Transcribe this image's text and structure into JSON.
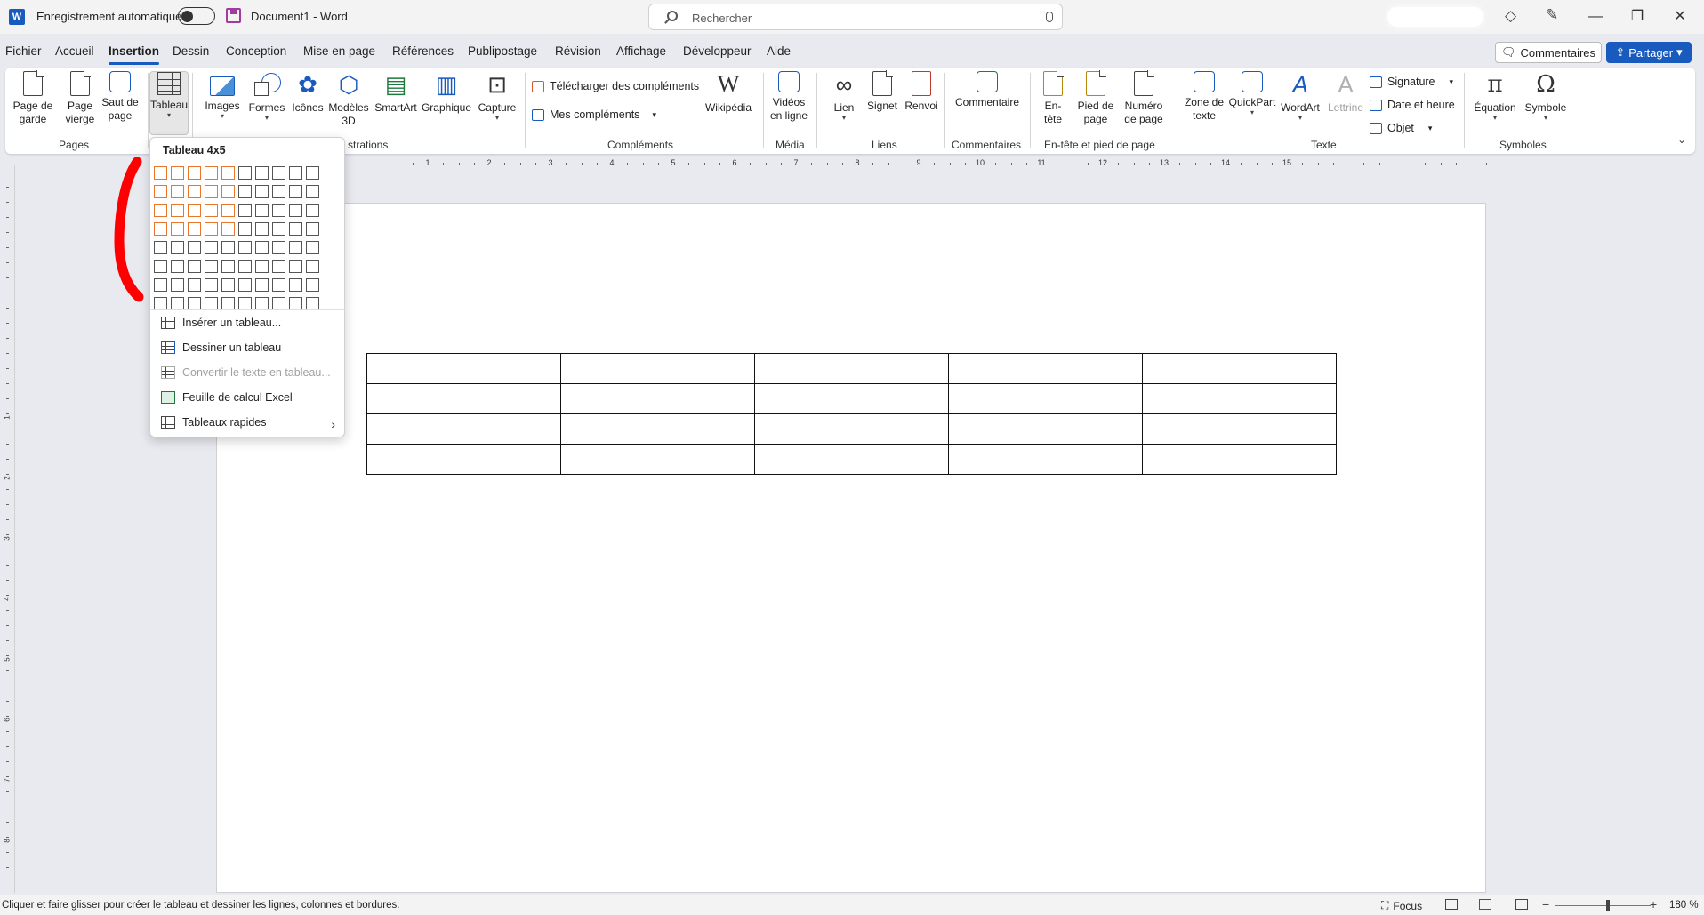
{
  "titlebar": {
    "autosave_label": "Enregistrement automatique",
    "document_title": "Document1  -  Word",
    "search_placeholder": "Rechercher"
  },
  "menu": {
    "tabs": [
      "Fichier",
      "Accueil",
      "Insertion",
      "Dessin",
      "Conception",
      "Mise en page",
      "Références",
      "Publipostage",
      "Révision",
      "Affichage",
      "Développeur",
      "Aide"
    ],
    "active_tab": "Insertion",
    "comments_label": "Commentaires",
    "share_label": "Partager"
  },
  "ribbon": {
    "pages": {
      "cover": "Page de\ngarde",
      "blank": "Page\nvierge",
      "break": "Saut de\npage",
      "group": "Pages"
    },
    "table": {
      "label": "Tableau"
    },
    "illustrations": {
      "images": "Images",
      "shapes": "Formes",
      "icons": "Icônes",
      "models3d": "Modèles\n3D",
      "smartart": "SmartArt",
      "chart": "Graphique",
      "capture": "Capture",
      "group": "strations"
    },
    "addins": {
      "download": "Télécharger des compléments",
      "my": "Mes compléments",
      "wikipedia": "Wikipédia",
      "group": "Compléments"
    },
    "media": {
      "online_video": "Vidéos\nen ligne",
      "group": "Média"
    },
    "links": {
      "link": "Lien",
      "bookmark": "Signet",
      "crossref": "Renvoi",
      "group": "Liens"
    },
    "comments": {
      "comment": "Commentaire",
      "group": "Commentaires"
    },
    "header_footer": {
      "header": "En-\ntête",
      "footer": "Pied de\npage",
      "page_number": "Numéro\nde page",
      "group": "En-tête et pied de page"
    },
    "text": {
      "textbox": "Zone de\ntexte",
      "quickpart": "QuickPart",
      "wordart": "WordArt",
      "dropcap": "Lettrine",
      "signature": "Signature",
      "datetime": "Date et heure",
      "object": "Objet",
      "group": "Texte"
    },
    "symbols": {
      "equation": "Équation",
      "symbol": "Symbole",
      "group": "Symboles"
    }
  },
  "table_dropdown": {
    "title": "Tableau 4x5",
    "grid_cols": 10,
    "grid_rows": 8,
    "selected_cols": 5,
    "selected_rows": 4,
    "items": {
      "insert": "Insérer un tableau...",
      "draw": "Dessiner un tableau",
      "convert": "Convertir le texte en tableau...",
      "excel": "Feuille de calcul Excel",
      "quick": "Tableaux rapides"
    }
  },
  "ruler": {
    "h_numbers": [
      "1",
      "2",
      "3",
      "4",
      "5",
      "6",
      "7",
      "8",
      "9",
      "10",
      "11",
      "12",
      "13",
      "14",
      "15"
    ],
    "v_numbers": [
      "1",
      "2",
      "3",
      "4",
      "5",
      "6",
      "7",
      "8"
    ]
  },
  "document_table": {
    "rows": 4,
    "cols": 5
  },
  "statusbar": {
    "hint": "Cliquer et faire glisser pour créer le tableau et dessiner les lignes, colonnes et bordures.",
    "focus": "Focus",
    "zoom": "180 %"
  },
  "colors": {
    "accent": "#185abd",
    "grid_selected": "#e8762b",
    "annotation": "#ff0000"
  }
}
